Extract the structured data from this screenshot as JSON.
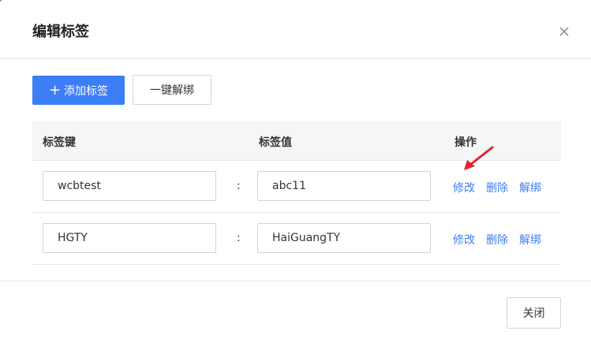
{
  "dialog": {
    "title": "编辑标签",
    "close_icon": "close-icon"
  },
  "toolbar": {
    "add_label": "添加标签",
    "add_icon": "plus-icon",
    "unbind_all_label": "一键解绑"
  },
  "table": {
    "headers": {
      "key": "标签键",
      "value": "标签值",
      "actions": "操作"
    },
    "rows": [
      {
        "key": "wcbtest",
        "sep": ":",
        "value": "abc11",
        "edit": "修改",
        "delete": "删除",
        "unbind": "解绑"
      },
      {
        "key": "HGTY",
        "sep": ":",
        "value": "HaiGuangTY",
        "edit": "修改",
        "delete": "删除",
        "unbind": "解绑"
      }
    ]
  },
  "footer": {
    "close_label": "关闭"
  },
  "colors": {
    "primary": "#3c7ef5",
    "annotation_arrow": "#e8242b"
  }
}
